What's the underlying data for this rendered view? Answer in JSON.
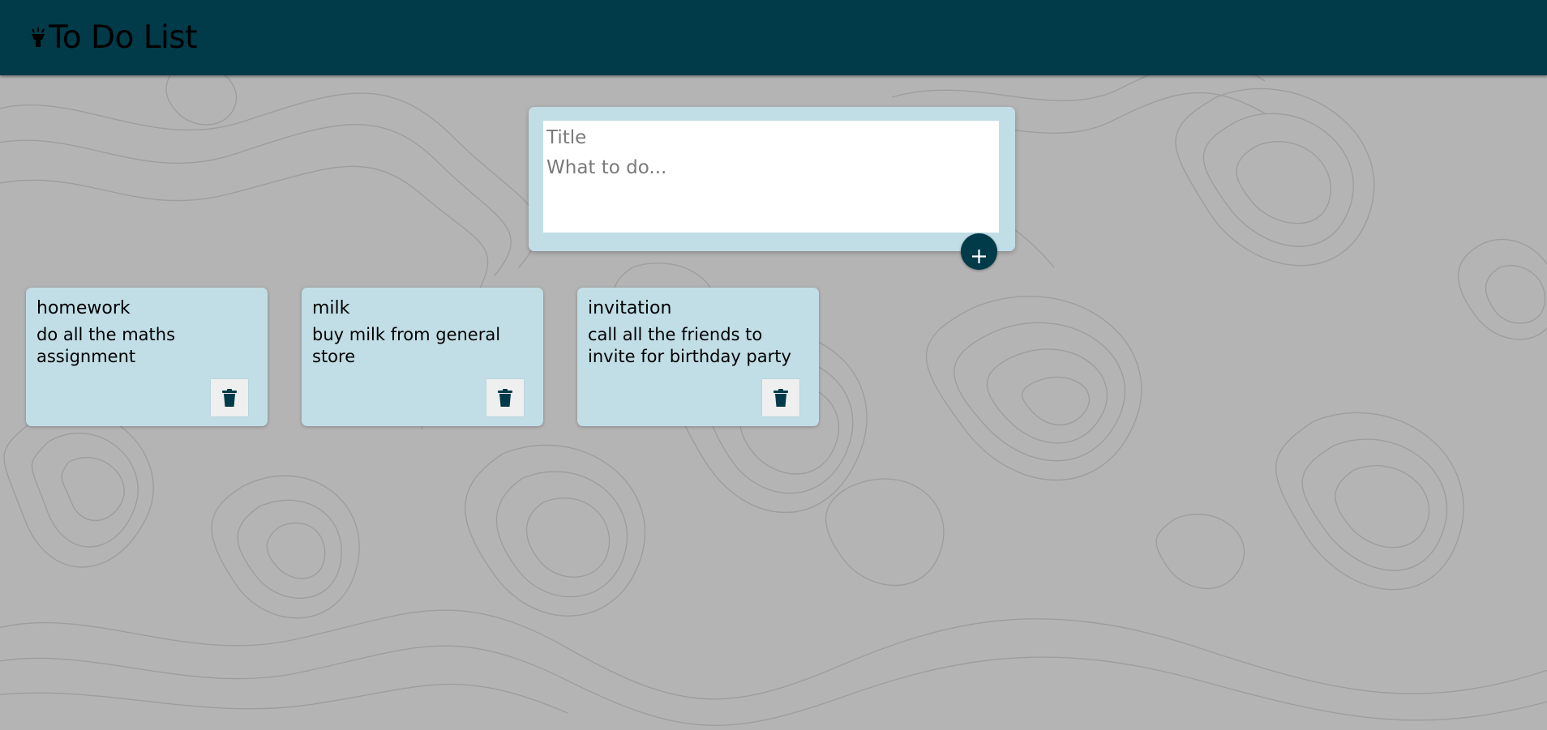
{
  "header": {
    "title": "To Do List",
    "icon": "lamp-icon",
    "background_color": "#013a48"
  },
  "composer": {
    "title_placeholder": "Title",
    "title_value": "",
    "content_placeholder": "What to do...",
    "content_value": "",
    "add_icon": "plus-icon"
  },
  "notes": [
    {
      "title": "homework",
      "content": "do all the maths assignment",
      "delete_icon": "trash-icon"
    },
    {
      "title": "milk",
      "content": "buy milk from general store",
      "delete_icon": "trash-icon"
    },
    {
      "title": "invitation",
      "content": "call all the friends to invite for birthday party",
      "delete_icon": "trash-icon"
    }
  ],
  "colors": {
    "note_background": "#c1dee6",
    "accent": "#013a48",
    "page_background": "#b4b4b4"
  }
}
